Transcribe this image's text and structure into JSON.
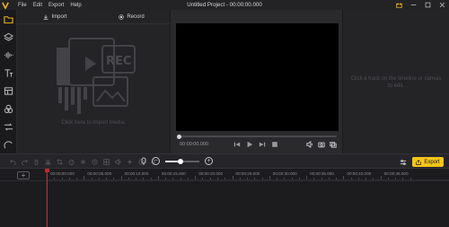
{
  "titlebar": {
    "menu": [
      "File",
      "Edit",
      "Export",
      "Help"
    ],
    "title": "Untitled Project - 00:00:00.000"
  },
  "sidebar": {
    "items": [
      {
        "icon": "folder-icon",
        "active": true
      },
      {
        "icon": "layers-icon",
        "active": false
      },
      {
        "icon": "audio-wave-icon",
        "active": false
      },
      {
        "icon": "text-icon",
        "active": false
      },
      {
        "icon": "template-icon",
        "active": false
      },
      {
        "icon": "effects-icon",
        "active": false
      },
      {
        "icon": "transition-icon",
        "active": false
      },
      {
        "icon": "sticker-icon",
        "active": false
      }
    ]
  },
  "media": {
    "tabs": [
      {
        "label": "Import",
        "icon": "download-icon"
      },
      {
        "label": "Record",
        "icon": "record-icon"
      }
    ],
    "illustration_text": "REC",
    "hint": "Click here to import media."
  },
  "preview": {
    "timecode": "00:00:00.000",
    "progress": 0
  },
  "properties": {
    "hint": "Click a track on the timeline or canvas to edit."
  },
  "timeline": {
    "export_label": "Export",
    "zoom_level": 0.45,
    "ruler": [
      "00:00:00.000",
      "00:00:05.000",
      "00:00:10.000",
      "00:00:15.000",
      "00:00:20.000",
      "00:00:25.000",
      "00:00:30.000",
      "00:00:35.000",
      "00:00:40.000",
      "00:00:45.000"
    ],
    "accent": "#f5c518",
    "playhead_color": "#c0282a"
  }
}
